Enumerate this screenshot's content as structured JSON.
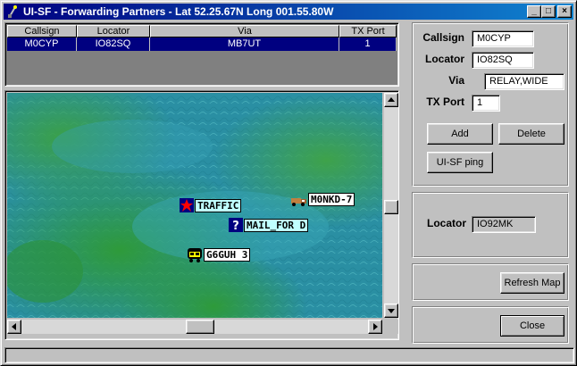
{
  "window": {
    "title": "UI-SF - Forwarding Partners  - Lat 52.25.67N Long 001.55.80W",
    "controls": {
      "minimize": "_",
      "maximize": "□",
      "close": "×"
    }
  },
  "grid": {
    "columns": [
      "Callsign",
      "Locator",
      "Via",
      "TX Port"
    ],
    "rows": [
      {
        "callsign": "M0CYP",
        "locator": "IO82SQ",
        "via": "MB7UT",
        "tx_port": "1"
      }
    ]
  },
  "map": {
    "stations": [
      {
        "label": "TRAFFIC",
        "icon": "red-star-icon"
      },
      {
        "label": "MAIL_FOR D",
        "icon": "question-mark-icon"
      },
      {
        "label": "M0NKD-7",
        "icon": "truck-icon"
      },
      {
        "label": "G6GUH 3",
        "icon": "bus-icon"
      }
    ]
  },
  "form": {
    "callsign_label": "Callsign",
    "callsign_value": "M0CYP",
    "locator_label": "Locator",
    "locator_value": "IO82SQ",
    "via_label": "Via",
    "via_value": "RELAY,WIDE",
    "txport_label": "TX Port",
    "txport_value": "1",
    "add_label": "Add",
    "delete_label": "Delete",
    "ping_label": "UI-SF ping"
  },
  "locator_panel": {
    "label": "Locator",
    "value": "IO92MK"
  },
  "refresh_label": "Refresh Map",
  "close_label": "Close",
  "colors": {
    "title_bar": "#000080",
    "selection": "#000080",
    "window_bg": "#c0c0c0"
  }
}
